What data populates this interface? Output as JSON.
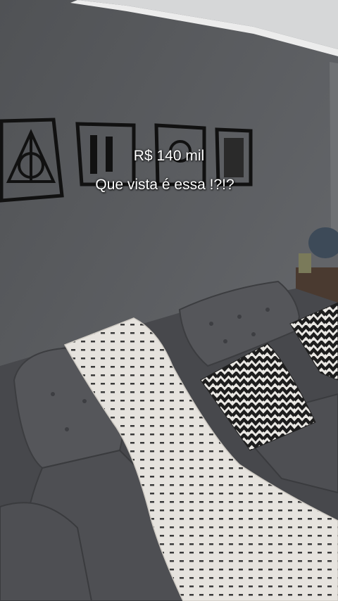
{
  "overlay": {
    "line1": "R$ 140 mil",
    "line2": "Que vista é essa !?!?"
  },
  "colors": {
    "wall": "#5d5f62",
    "ceiling": "#d9dadb",
    "sofa": "#4b4c50",
    "throw_blanket": "#e8e6e2",
    "pillow_pattern": "#1f1f1f"
  },
  "icons": [
    "deathly-hallows-frame",
    "wall-art-frame",
    "wall-art-frame",
    "wall-art-frame",
    "chevron-pillow"
  ]
}
